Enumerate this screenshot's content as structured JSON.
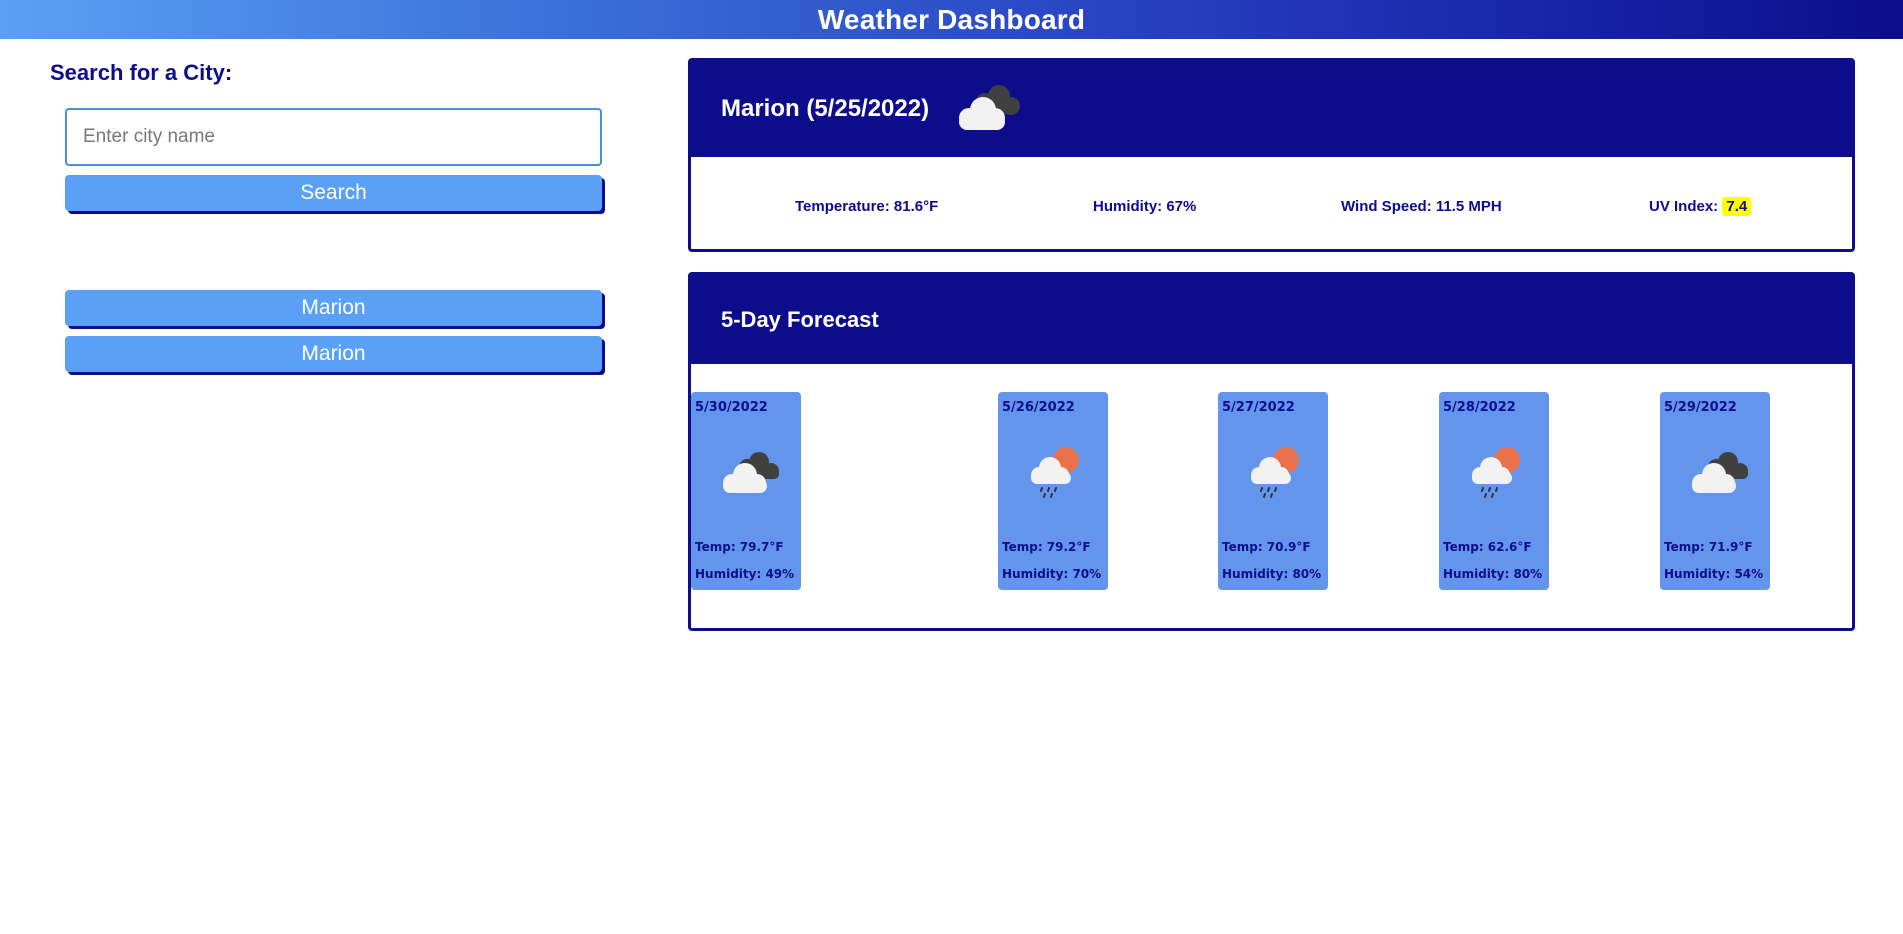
{
  "header": {
    "title": "Weather Dashboard"
  },
  "search": {
    "heading": "Search for a City:",
    "placeholder": "Enter city name",
    "value": "",
    "button_label": "Search"
  },
  "history": [
    {
      "label": "Marion"
    },
    {
      "label": "Marion"
    }
  ],
  "current": {
    "city_date": "Marion (5/25/2022)",
    "icon": "cloudy-icon",
    "temperature": "Temperature: 81.6°F",
    "humidity": "Humidity: 67%",
    "wind": "Wind Speed: 11.5 MPH",
    "uv_label": "UV Index: ",
    "uv_value": "7.4",
    "uv_color": "#ffff00"
  },
  "forecast": {
    "title": "5-Day Forecast",
    "days": [
      {
        "date": "5/26/2022",
        "icon": "rain-sun-icon",
        "temp": "Temp: 79.2°F",
        "humidity": "Humidity: 70%"
      },
      {
        "date": "5/27/2022",
        "icon": "rain-sun-icon",
        "temp": "Temp: 70.9°F",
        "humidity": "Humidity: 80%"
      },
      {
        "date": "5/28/2022",
        "icon": "rain-sun-icon",
        "temp": "Temp: 62.6°F",
        "humidity": "Humidity: 80%"
      },
      {
        "date": "5/29/2022",
        "icon": "cloudy-icon",
        "temp": "Temp: 71.9°F",
        "humidity": "Humidity: 54%"
      },
      {
        "date": "5/30/2022",
        "icon": "cloudy-icon",
        "temp": "Temp: 79.7°F",
        "humidity": "Humidity: 49%"
      }
    ]
  },
  "colors": {
    "navy": "#0c0c8c",
    "button": "#5aa0f7",
    "card": "#6495ed"
  }
}
